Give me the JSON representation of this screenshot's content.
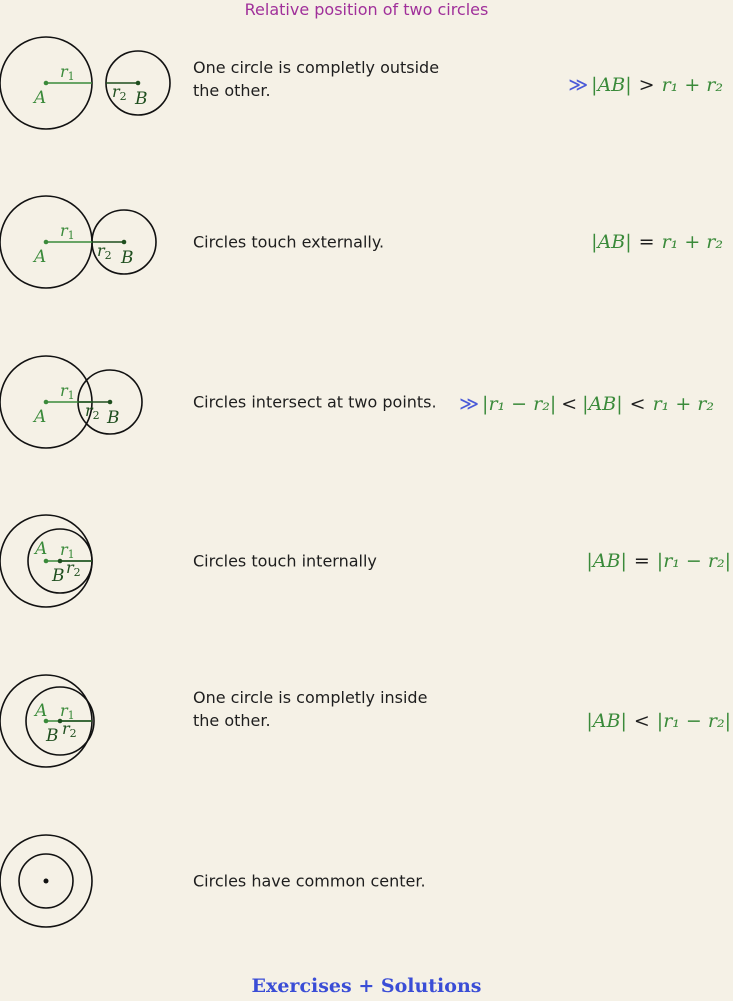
{
  "title": "Relative position of two circles",
  "rows": [
    {
      "description": "One circle is completly outside the other.",
      "marker": "≫",
      "lhs": "|AB|",
      "op": ">",
      "rhs": "r₁ + r₂",
      "labels": {
        "a": "A",
        "b": "B",
        "r1": "r1",
        "r2": "r2"
      }
    },
    {
      "description": "Circles touch externally.",
      "marker": "",
      "lhs": "|AB|",
      "op": "=",
      "rhs": "r₁ + r₂",
      "labels": {
        "a": "A",
        "b": "B",
        "r1": "r1",
        "r2": "r2"
      }
    },
    {
      "description": "Circles intersect at two points.",
      "marker": "≫",
      "prefix": "|r₁ − r₂|",
      "prefix_op": "<",
      "lhs": "|AB|",
      "op": "<",
      "rhs": "r₁ + r₂",
      "labels": {
        "a": "A",
        "b": "B",
        "r1": "r1",
        "r2": "r2"
      }
    },
    {
      "description": "Circles touch internally",
      "marker": "",
      "lhs": "|AB|",
      "op": "=",
      "rhs": "|r₁ − r₂|",
      "labels": {
        "a": "A",
        "b": "B",
        "r1": "r1",
        "r2": "r2"
      }
    },
    {
      "description": "One circle is completly inside the other.",
      "marker": "",
      "lhs": "|AB|",
      "op": "<",
      "rhs": "|r₁ − r₂|",
      "labels": {
        "a": "A",
        "b": "B",
        "r1": "r1",
        "r2": "r2"
      }
    },
    {
      "description": "Circles have common center.",
      "marker": "",
      "lhs": "",
      "op": "",
      "rhs": ""
    }
  ],
  "footer": "Exercises + Solutions",
  "colors": {
    "accent": "#3a8a3a",
    "title": "#a0309a",
    "link": "#3a4dd6",
    "background": "#f5f1e6"
  }
}
